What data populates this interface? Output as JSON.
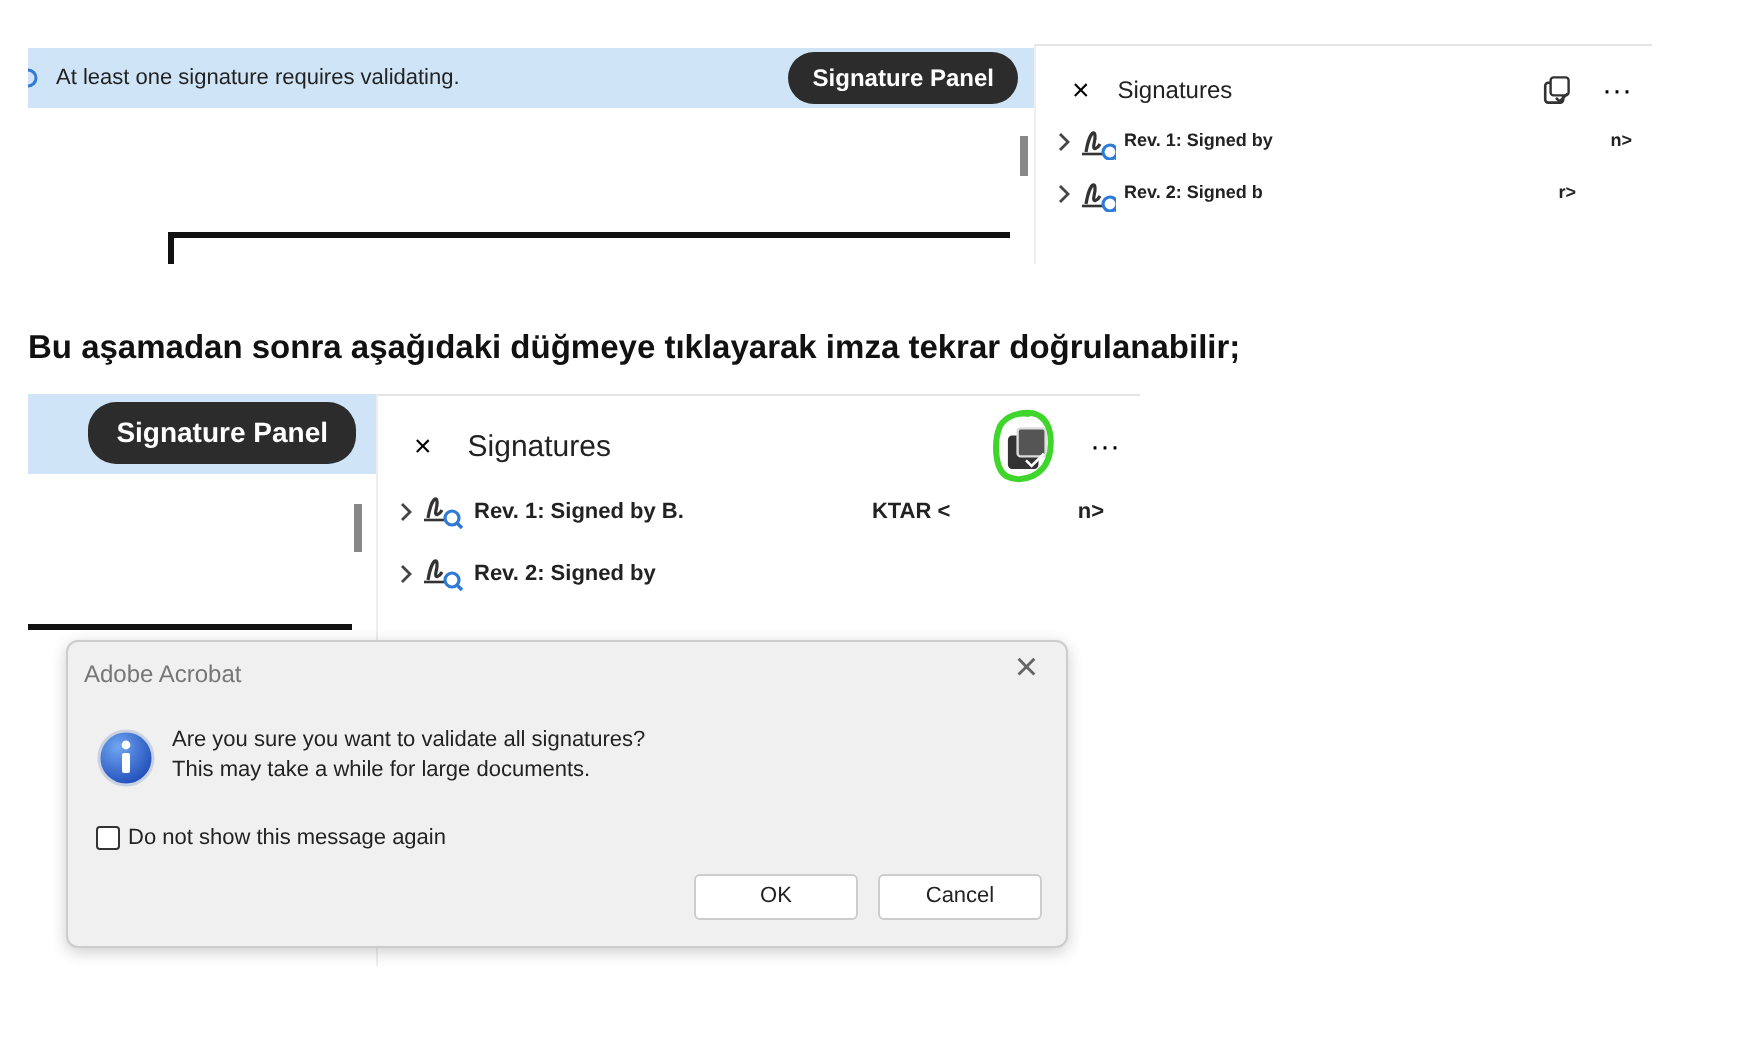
{
  "blocks": [
    {
      "kind": "screenshot",
      "banner": {
        "text": "At least one signature requires validating.",
        "button": "Signature Panel"
      },
      "panel": {
        "close": "×",
        "title": "Signatures",
        "validate_highlighted": false,
        "more": "···",
        "rows": [
          {
            "text": "Rev. 1: Signed by",
            "trailing": "n>"
          },
          {
            "text": "Rev. 2: Signed b",
            "trailing": "r>"
          }
        ]
      }
    },
    {
      "kind": "paragraph",
      "text": "Bu aşamadan sonra aşağıdaki düğmeye tıklayarak imza tekrar doğrulanabilir;"
    },
    {
      "kind": "screenshot",
      "banner": {
        "button": "Signature Panel"
      },
      "panel": {
        "close": "×",
        "title": "Signatures",
        "validate_highlighted": true,
        "more": "···",
        "rows": [
          {
            "text": "Rev. 1: Signed by B.",
            "middle": "KTAR <",
            "trailing": "n>"
          },
          {
            "text": "Rev. 2: Signed by"
          }
        ]
      },
      "dialog": {
        "title": "Adobe Acrobat",
        "close": "×",
        "message": [
          "Are you sure you want to validate all signatures?",
          "This may take a while for large documents."
        ],
        "checkbox": {
          "label": "Do not show this message again",
          "checked": false
        },
        "buttons": [
          "OK",
          "Cancel"
        ]
      }
    }
  ]
}
